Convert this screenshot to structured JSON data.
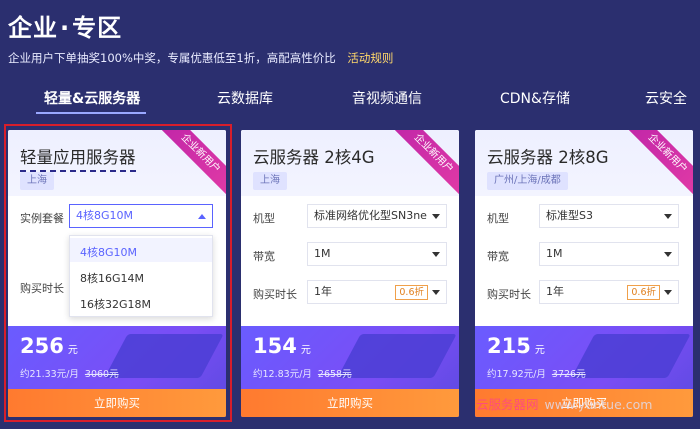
{
  "header": {
    "title_main": "企业",
    "title_dot": "·",
    "title_tail": "专区",
    "subtitle": "企业用户下单抽奖100%中奖，专属优惠低至1折，高配高性价比",
    "subtitle_link": "活动规则"
  },
  "tabs": [
    {
      "label": "轻量&云服务器",
      "active": true
    },
    {
      "label": "云数据库",
      "active": false
    },
    {
      "label": "音视频通信",
      "active": false
    },
    {
      "label": "CDN&存储",
      "active": false
    },
    {
      "label": "云安全",
      "active": false
    }
  ],
  "cards": [
    {
      "title": "轻量应用服务器",
      "ribbon": "企业新用户",
      "region": "上海",
      "rows": [
        {
          "label": "实例套餐",
          "value": "4核8G10M"
        },
        {
          "label": "购买时长",
          "value": ""
        }
      ],
      "dropdown_options": [
        "4核8G10M",
        "8核16G14M",
        "16核32G18M"
      ],
      "price": "256",
      "price_unit": "元",
      "monthly": "约21.33元/月",
      "original": "3060元",
      "button": "立即购买"
    },
    {
      "title": "云服务器 2核4G",
      "ribbon": "企业新用户",
      "region": "上海",
      "rows": [
        {
          "label": "机型",
          "value": "标准网络优化型SN3ne"
        },
        {
          "label": "带宽",
          "value": "1M"
        },
        {
          "label": "购买时长",
          "value": "1年",
          "discount": "0.6折"
        }
      ],
      "price": "154",
      "price_unit": "元",
      "monthly": "约12.83元/月",
      "original": "2658元",
      "button": "立即购买"
    },
    {
      "title": "云服务器 2核8G",
      "ribbon": "企业新用户",
      "region": "广州/上海/成都",
      "rows": [
        {
          "label": "机型",
          "value": "标准型S3"
        },
        {
          "label": "带宽",
          "value": "1M"
        },
        {
          "label": "购买时长",
          "value": "1年",
          "discount": "0.6折"
        }
      ],
      "price": "215",
      "price_unit": "元",
      "monthly": "约17.92元/月",
      "original": "3726元",
      "button": "立即购买"
    }
  ],
  "watermark": {
    "cn": "云服务器网",
    "en": "www.yuntue.com"
  },
  "colors": {
    "background": "#2b2f6f",
    "accent": "#5a63ff",
    "button": "#ff8a35",
    "highlight_border": "#d81e2b"
  }
}
